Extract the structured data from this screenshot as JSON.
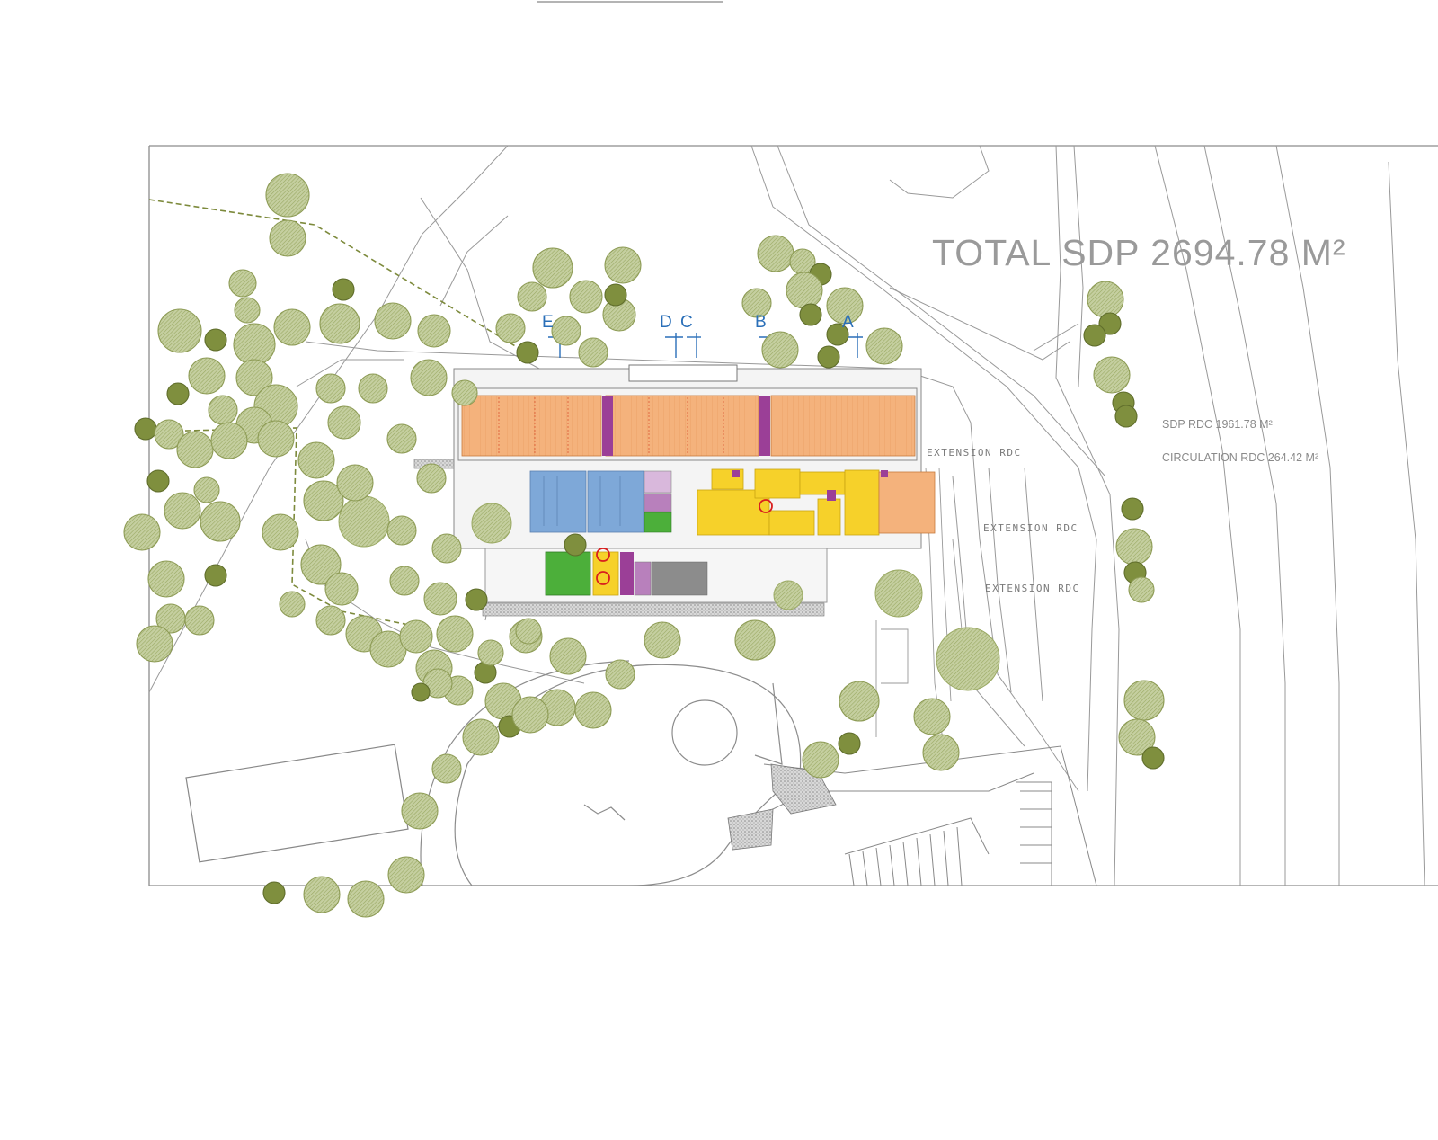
{
  "plan": {
    "total_sdp": "TOTAL SDP  2694.78 M²",
    "sdp_rdc": "SDP RDC  1961.78 M²",
    "circulation_rdc": "CIRCULATION RDC 264.42 M²",
    "extensions": [
      "EXTENSION RDC",
      "EXTENSION RDC",
      "EXTENSION RDC"
    ],
    "section_markers": {
      "a": "A",
      "b": "B",
      "c": "C",
      "d": "D",
      "e": "E"
    }
  },
  "colors": {
    "tree_fill": "#b6c38c",
    "tree_dark": "#7f8f3e",
    "line": "#8c8c8c",
    "orange": "#f4b27c",
    "yellow": "#f6d12a",
    "blue": "#7ea8d8",
    "green": "#4caf3a",
    "purple": "#9b3f97",
    "section_blue": "#2a6fb8"
  }
}
